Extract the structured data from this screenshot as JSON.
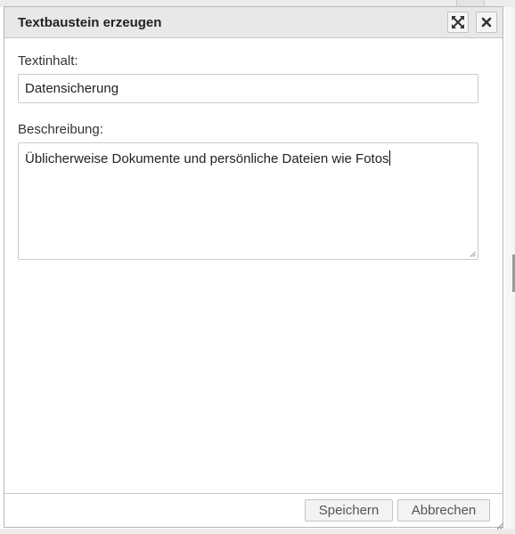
{
  "dialog": {
    "title": "Textbaustein erzeugen",
    "maximize_icon": "maximize-icon",
    "close_icon": "close-icon"
  },
  "form": {
    "text_label": "Textinhalt:",
    "text_value": "Datensicherung",
    "description_label": "Beschreibung:",
    "description_value": "Üblicherweise Dokumente und persönliche Dateien wie Fotos"
  },
  "footer": {
    "save_label": "Speichern",
    "cancel_label": "Abbrechen"
  },
  "colors": {
    "titlebar_bg": "#e8e8e8",
    "border": "#cccccc",
    "button_bg": "#f3f3f3"
  }
}
